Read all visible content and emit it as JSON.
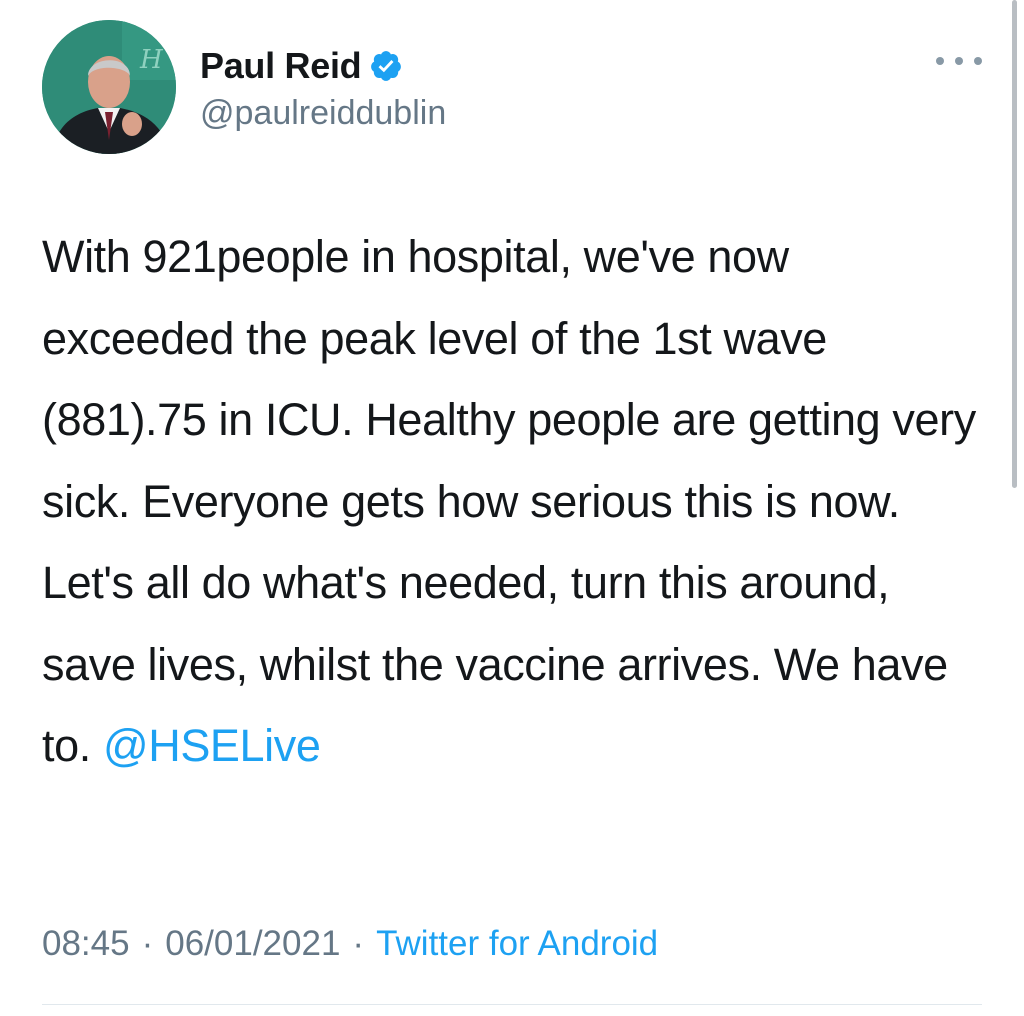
{
  "author": {
    "display_name": "Paul Reid",
    "handle": "@paulreiddublin",
    "verified": true,
    "verified_color": "#1da1f2"
  },
  "tweet": {
    "text": "With 921people in hospital, we've now exceeded the peak level of the 1st wave (881).75 in ICU. Healthy people are getting very sick. Everyone gets how serious this is now. Let's all do what's needed, turn this around, save lives, whilst the vaccine arrives. We have to. ",
    "mention": "@HSELive",
    "time": "08:45",
    "date": "06/01/2021",
    "separator": "·",
    "source": "Twitter for Android"
  },
  "icons": {
    "more": "more-horizontal-icon",
    "verified": "verified-badge-icon"
  },
  "colors": {
    "link": "#1da1f2",
    "secondary_text": "#657786",
    "primary_text": "#14171a"
  }
}
